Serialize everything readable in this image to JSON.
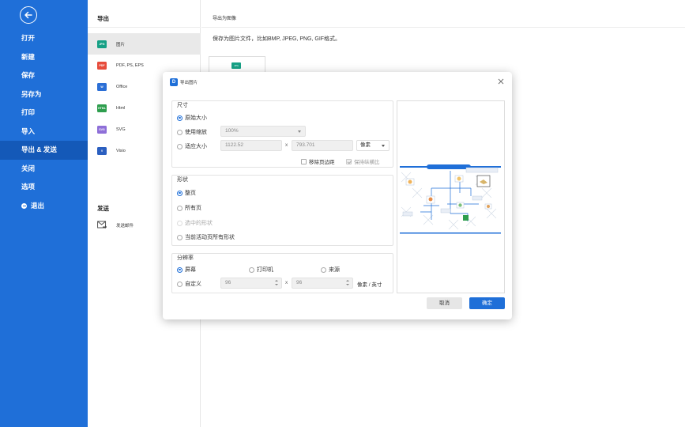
{
  "sidebar": {
    "items": [
      {
        "label": "打开"
      },
      {
        "label": "新建"
      },
      {
        "label": "保存"
      },
      {
        "label": "另存为"
      },
      {
        "label": "打印"
      },
      {
        "label": "导入"
      },
      {
        "label": "导出 & 发送",
        "active": true
      },
      {
        "label": "关闭"
      },
      {
        "label": "选项"
      },
      {
        "label": "退出"
      }
    ]
  },
  "export_panel": {
    "title": "导出",
    "formats": [
      {
        "label": "图片",
        "icon_text": "JPG",
        "color": "#16a085"
      },
      {
        "label": "PDF, PS, EPS",
        "icon_text": "PDF",
        "color": "#e74c3c"
      },
      {
        "label": "Office",
        "icon_text": "W",
        "color": "#2b6fd6"
      },
      {
        "label": "Html",
        "icon_text": "HTML",
        "color": "#2e9e4e"
      },
      {
        "label": "SVG",
        "icon_text": "SVG",
        "color": "#8e6fd8"
      },
      {
        "label": "Visio",
        "icon_text": "V",
        "color": "#2b5fc0"
      }
    ],
    "send_title": "发送",
    "send_email_label": "发送邮件"
  },
  "main": {
    "title": "导出为图像",
    "description": "保存为图片文件，比如BMP, JPEG, PNG, GIF格式。",
    "thumb_text": "JPG"
  },
  "dialog": {
    "title": "导出图片",
    "logo_text": "D",
    "size": {
      "title": "尺寸",
      "original": "原始大小",
      "use_zoom": "使用缩放",
      "zoom_value": "100%",
      "fit": "适应大小",
      "width": "1122.52",
      "height": "793.701",
      "unit": "像素",
      "remove_margin": "移除页边距",
      "keep_ratio": "保持纵横比",
      "x": "x"
    },
    "shape": {
      "title": "形状",
      "whole_page": "整页",
      "all_pages": "所有页",
      "selected": "选中的形状",
      "current_page_all": "当前活动页所有形状"
    },
    "resolution": {
      "title": "分辨率",
      "screen": "屏幕",
      "printer": "打印机",
      "source": "来源",
      "custom": "自定义",
      "dpi_x": "96",
      "dpi_y": "96",
      "unit": "像素 / 英寸",
      "x": "x"
    },
    "buttons": {
      "cancel": "取消",
      "ok": "确定"
    }
  },
  "colors": {
    "accent": "#1f6fd8",
    "sidebar_active": "#1459b8"
  }
}
